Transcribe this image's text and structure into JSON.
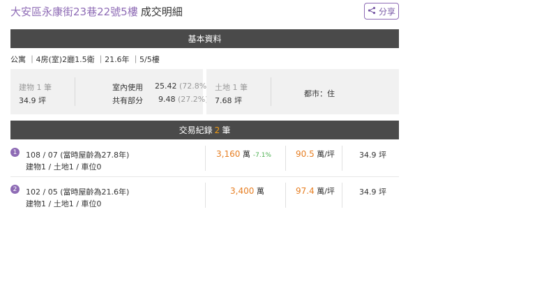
{
  "header": {
    "address": "大安區永康街23巷22號5樓",
    "suffix": "成交明細",
    "share_label": "分享"
  },
  "basic_bar": {
    "title": "基本資料"
  },
  "summary": "公寓 ｜4房(室)2廳1.5衛 ｜21.6年 ｜5/5樓",
  "building": {
    "label": "建物 1 筆",
    "area": "34.9 坪",
    "indoor_label": "室內使用",
    "indoor_value": "25.42",
    "indoor_pct": "(72.8%)",
    "shared_label": "共有部分",
    "shared_value": "9.48",
    "shared_pct": "(27.2%)"
  },
  "land": {
    "label": "土地 1 筆",
    "area": "7.68 坪",
    "zoning": "都市：住"
  },
  "trans_bar": {
    "prefix": "交易紀錄",
    "count": "2",
    "suffix": "筆"
  },
  "transactions": [
    {
      "index": "1",
      "date": "108 / 07 (當時屋齡為27.8年)",
      "detail": "建物1 / 土地1 / 車位0",
      "price": "3,160",
      "price_unit": "萬",
      "change": "-7.1%",
      "unit_price": "90.5",
      "unit_price_unit": "萬/坪",
      "area": "34.9 坪"
    },
    {
      "index": "2",
      "date": "102 / 05 (當時屋齡為21.6年)",
      "detail": "建物1 / 土地1 / 車位0",
      "price": "3,400",
      "price_unit": "萬",
      "change": "",
      "unit_price": "97.4",
      "unit_price_unit": "萬/坪",
      "area": "34.9 坪"
    }
  ],
  "colors": {
    "accent": "#8e6bb5",
    "bar": "#4a4a4a",
    "price": "#e67e22",
    "change": "#4caf50"
  },
  "icons": {
    "share": "share-icon"
  }
}
